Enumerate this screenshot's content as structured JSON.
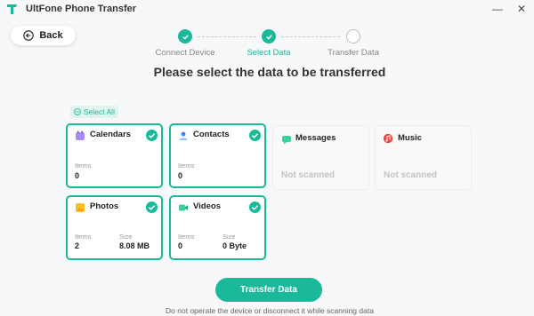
{
  "window": {
    "title": "UltFone Phone Transfer",
    "minimize_glyph": "—",
    "close_glyph": "✕"
  },
  "back_button": {
    "label": "Back",
    "icon": "back-arrow-icon"
  },
  "stepper": {
    "steps": [
      {
        "label": "Connect Device",
        "state": "done"
      },
      {
        "label": "Select Data",
        "state": "current"
      },
      {
        "label": "Transfer Data",
        "state": "pending"
      }
    ]
  },
  "page_title": "Please select the data to be transferred",
  "select_all_label": "Select All",
  "cards": [
    {
      "name": "Calendars",
      "icon": "calendar-icon",
      "selected": true,
      "items_label": "Items",
      "items": "0"
    },
    {
      "name": "Contacts",
      "icon": "contacts-icon",
      "selected": true,
      "items_label": "Items",
      "items": "0"
    },
    {
      "name": "Messages",
      "icon": "messages-icon",
      "selected": false,
      "status": "Not scanned"
    },
    {
      "name": "Music",
      "icon": "music-icon",
      "selected": false,
      "status": "Not scanned"
    },
    {
      "name": "Photos",
      "icon": "photos-icon",
      "selected": true,
      "items_label": "Items",
      "items": "2",
      "size_label": "Size",
      "size": "8.08 MB"
    },
    {
      "name": "Videos",
      "icon": "videos-icon",
      "selected": true,
      "items_label": "Items",
      "items": "0",
      "size_label": "Size",
      "size": "0 Byte"
    }
  ],
  "transfer_button": "Transfer Data",
  "footer_note": "Do not operate the device or disconnect it while scanning data",
  "colors": {
    "accent": "#19b99a",
    "accent_light": "#dff4ef"
  }
}
